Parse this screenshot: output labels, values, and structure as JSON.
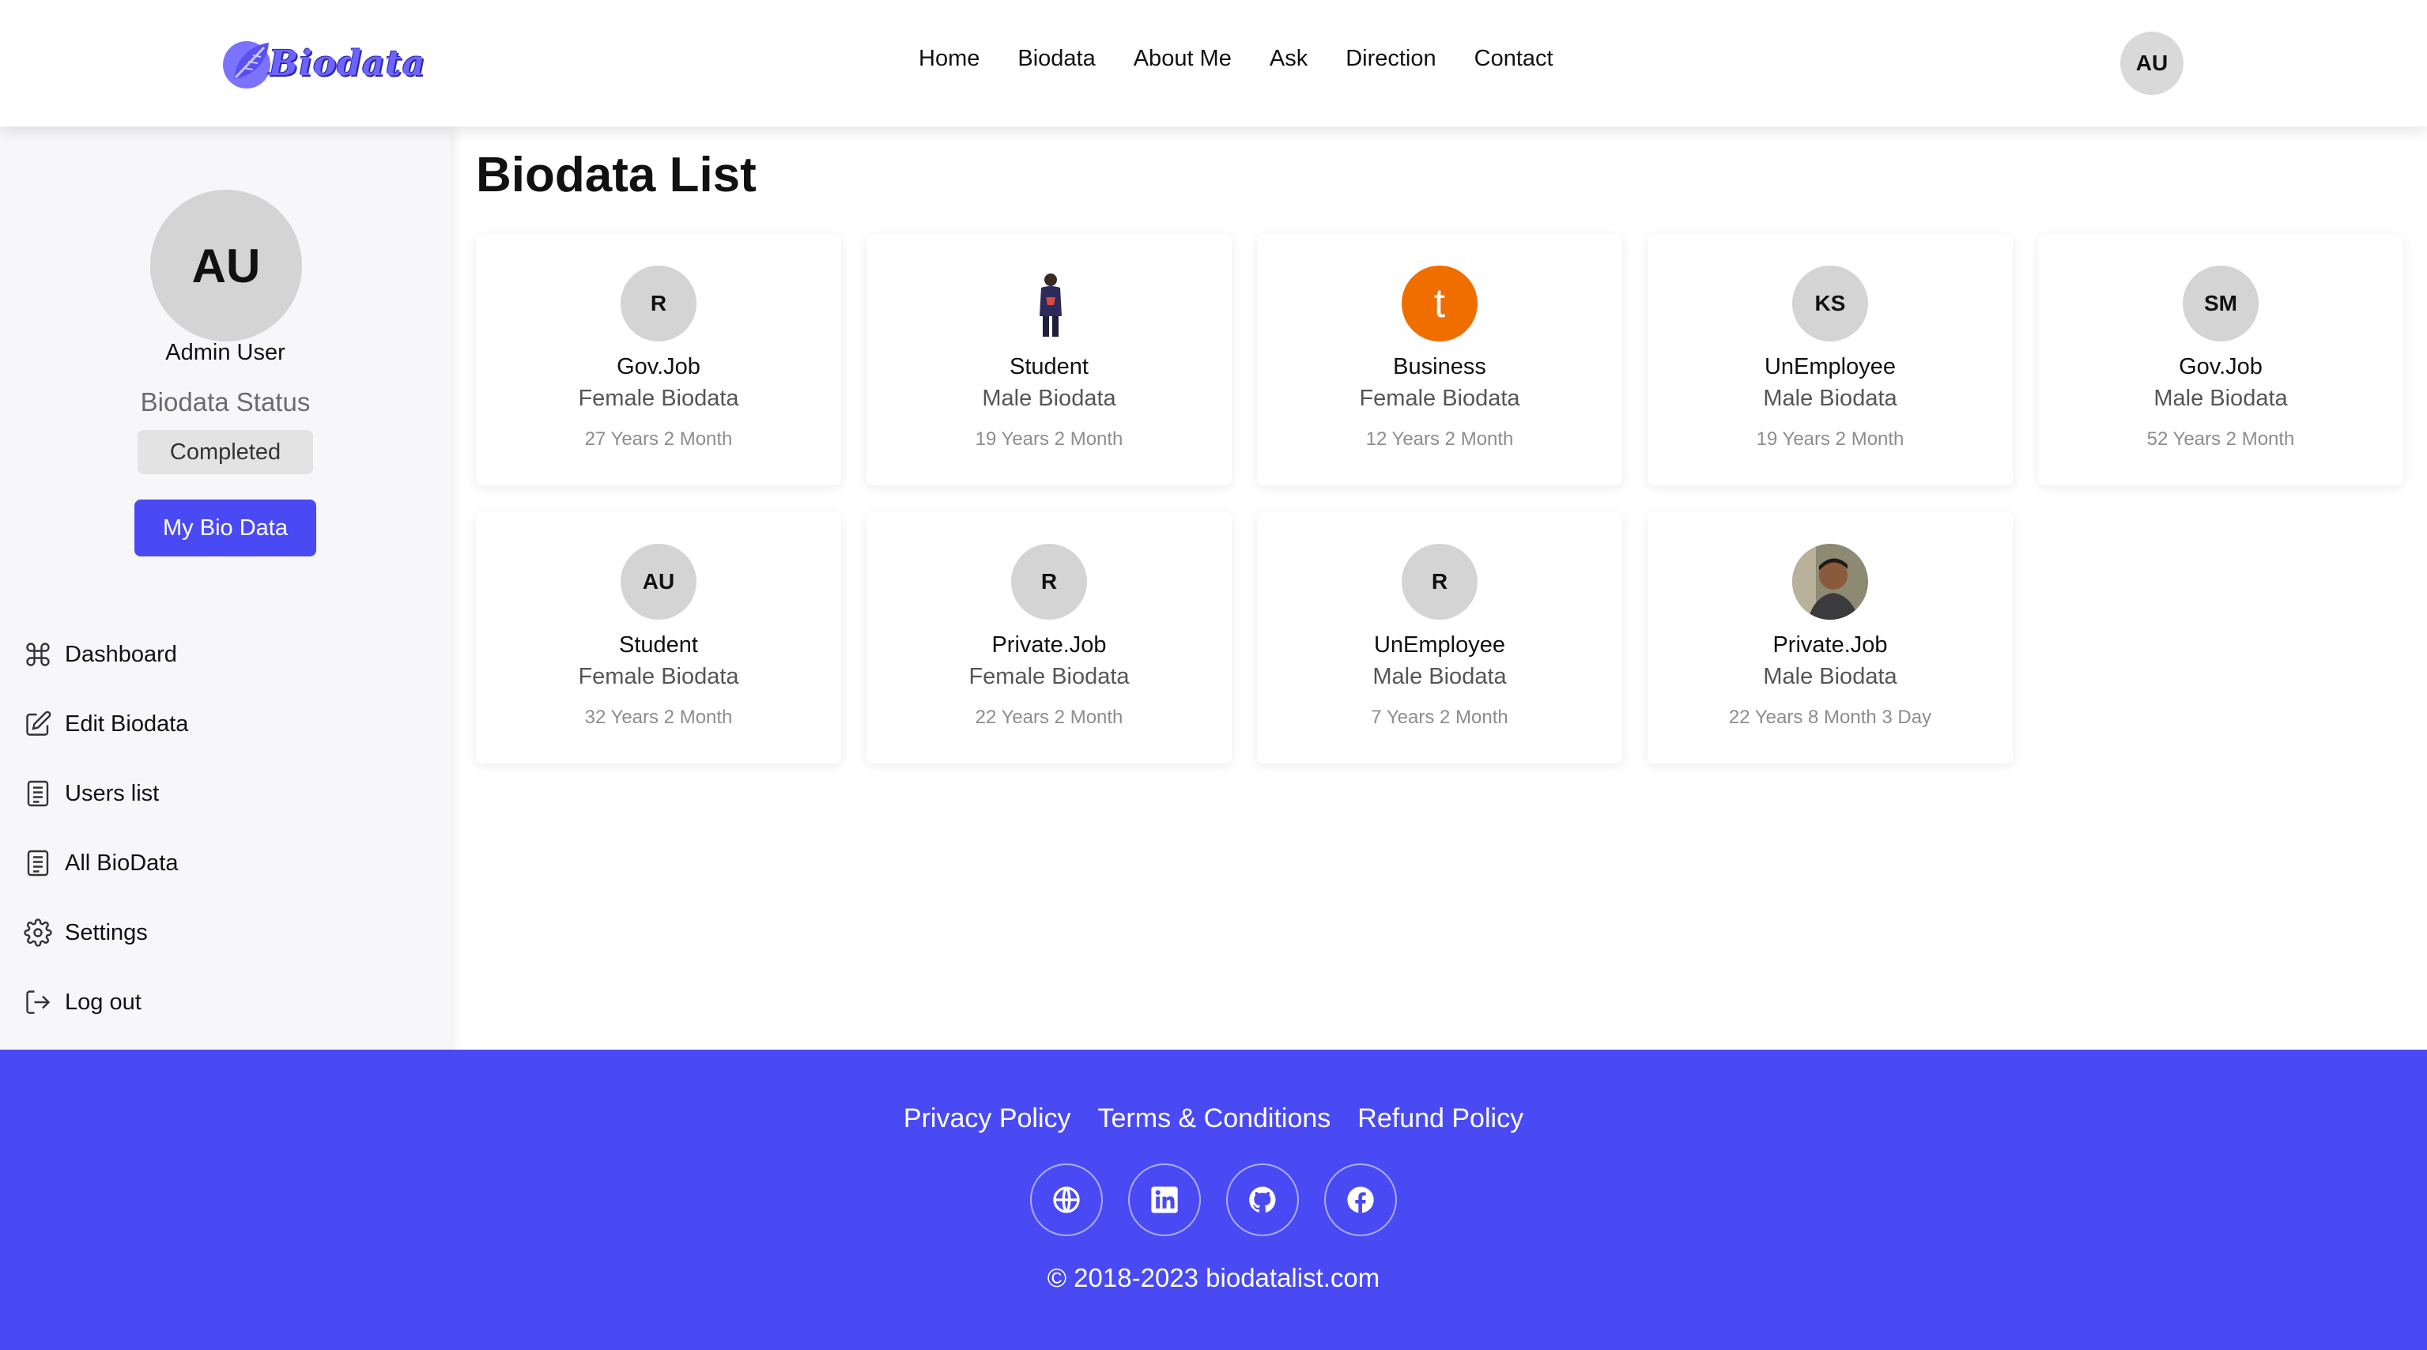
{
  "brand": {
    "name": "Biodata",
    "accent": "#4a4af4"
  },
  "nav": {
    "links": [
      "Home",
      "Biodata",
      "About Me",
      "Ask",
      "Direction",
      "Contact"
    ],
    "avatar_initials": "AU"
  },
  "sidebar": {
    "avatar_initials": "AU",
    "name": "Admin User",
    "status_title": "Biodata Status",
    "status_value": "Completed",
    "button_label": "My Bio Data",
    "menu": [
      {
        "label": "Dashboard",
        "icon": "command-icon"
      },
      {
        "label": "Edit Biodata",
        "icon": "edit-icon"
      },
      {
        "label": "Users list",
        "icon": "list-icon"
      },
      {
        "label": "All BioData",
        "icon": "list-icon"
      },
      {
        "label": "Settings",
        "icon": "gear-icon"
      },
      {
        "label": "Log out",
        "icon": "logout-icon"
      }
    ]
  },
  "main": {
    "title": "Biodata List",
    "cards": [
      {
        "avatar": "R",
        "avatar_type": "initials",
        "occupation": "Gov.Job",
        "type": "Female Biodata",
        "age": "27 Years 2 Month"
      },
      {
        "avatar": "",
        "avatar_type": "photo-person-standing",
        "occupation": "Student",
        "type": "Male Biodata",
        "age": "19 Years 2 Month"
      },
      {
        "avatar": "t",
        "avatar_type": "orange",
        "occupation": "Business",
        "type": "Female Biodata",
        "age": "12 Years 2 Month"
      },
      {
        "avatar": "KS",
        "avatar_type": "initials",
        "occupation": "UnEmployee",
        "type": "Male Biodata",
        "age": "19 Years 2 Month"
      },
      {
        "avatar": "SM",
        "avatar_type": "initials",
        "occupation": "Gov.Job",
        "type": "Male Biodata",
        "age": "52 Years 2 Month"
      },
      {
        "avatar": "AU",
        "avatar_type": "initials",
        "occupation": "Student",
        "type": "Female Biodata",
        "age": "32 Years 2 Month"
      },
      {
        "avatar": "R",
        "avatar_type": "initials",
        "occupation": "Private.Job",
        "type": "Female Biodata",
        "age": "22 Years 2 Month"
      },
      {
        "avatar": "R",
        "avatar_type": "initials",
        "occupation": "UnEmployee",
        "type": "Male Biodata",
        "age": "7 Years 2 Month"
      },
      {
        "avatar": "",
        "avatar_type": "photo-portrait",
        "occupation": "Private.Job",
        "type": "Male Biodata",
        "age": "22 Years 8 Month 3 Day"
      }
    ]
  },
  "footer": {
    "links": [
      "Privacy Policy",
      "Terms & Conditions",
      "Refund Policy"
    ],
    "socials": [
      "globe-icon",
      "linkedin-icon",
      "github-icon",
      "facebook-icon"
    ],
    "copyright": "© 2018-2023 biodatalist.com"
  }
}
